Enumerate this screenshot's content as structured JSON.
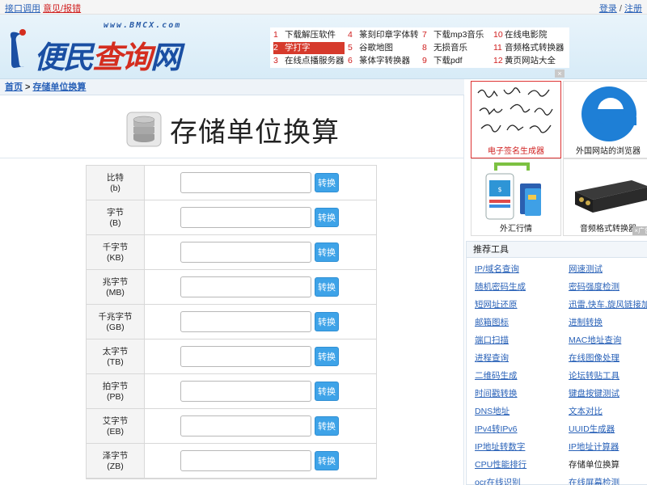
{
  "topbar": {
    "api_link": "接口调用",
    "feedback_link": "意见/报错",
    "login": "登录",
    "separator": "/",
    "register": "注册"
  },
  "logo": {
    "domain": "www.BMCX.com",
    "brand_blue": "便民",
    "brand_red": "查询",
    "brand_blue2": "网"
  },
  "hotlinks": [
    {
      "num": "1",
      "label": "下载解压软件"
    },
    {
      "num": "2",
      "label": "学打字"
    },
    {
      "num": "3",
      "label": "在线点播服务器"
    },
    {
      "num": "4",
      "label": "篆刻印章字体转"
    },
    {
      "num": "5",
      "label": "谷歌地图"
    },
    {
      "num": "6",
      "label": "篆体字转换器"
    },
    {
      "num": "7",
      "label": "下载mp3音乐"
    },
    {
      "num": "8",
      "label": "无损音乐"
    },
    {
      "num": "9",
      "label": "下载pdf"
    },
    {
      "num": "10",
      "label": "在线电影院"
    },
    {
      "num": "11",
      "label": "音频格式转换器"
    },
    {
      "num": "12",
      "label": "黄页网站大全"
    }
  ],
  "hot_close": "×",
  "breadcrumb": {
    "home": "首页",
    "current": "存储单位换算"
  },
  "page_title": "存储单位换算",
  "converter": {
    "button_label": "转换",
    "rows": [
      {
        "name": "比特",
        "abbr": "(b)",
        "value": ""
      },
      {
        "name": "字节",
        "abbr": "(B)",
        "value": ""
      },
      {
        "name": "千字节",
        "abbr": "(KB)",
        "value": ""
      },
      {
        "name": "兆字节",
        "abbr": "(MB)",
        "value": ""
      },
      {
        "name": "千兆字节",
        "abbr": "(GB)",
        "value": ""
      },
      {
        "name": "太字节",
        "abbr": "(TB)",
        "value": ""
      },
      {
        "name": "拍字节",
        "abbr": "(PB)",
        "value": ""
      },
      {
        "name": "艾字节",
        "abbr": "(EB)",
        "value": ""
      },
      {
        "name": "泽字节",
        "abbr": "(ZB)",
        "value": ""
      }
    ]
  },
  "sidebar_ads": [
    {
      "caption": "电子签名生成器"
    },
    {
      "caption": "外国网站的浏览器"
    },
    {
      "caption": "外汇行情"
    },
    {
      "caption": "音频格式转换器"
    }
  ],
  "ad_close_tag": "×广告",
  "tools": {
    "heading": "推荐工具",
    "left": [
      "IP/域名查询",
      "随机密码生成",
      "短网址还原",
      "邮箱图标",
      "端口扫描",
      "进程查询",
      "二维码生成",
      "时间戳转换",
      "DNS地址",
      "IPv4转IPv6",
      "IP地址转数字",
      "CPU性能排行",
      "ocr在线识别"
    ],
    "right": [
      "网速测试",
      "密码强度检测",
      "迅雷,快车,旋风链接加密",
      "进制转换",
      "MAC地址查询",
      "在线图像处理",
      "论坛转贴工具",
      "键盘按键测试",
      "文本对比",
      "UUID生成器",
      "IP地址计算器",
      "存储单位换算",
      "在线屏幕检测"
    ]
  },
  "colors": {
    "link": "#2a62b8",
    "accent_red": "#d63a2c",
    "button": "#3ea3e8"
  }
}
